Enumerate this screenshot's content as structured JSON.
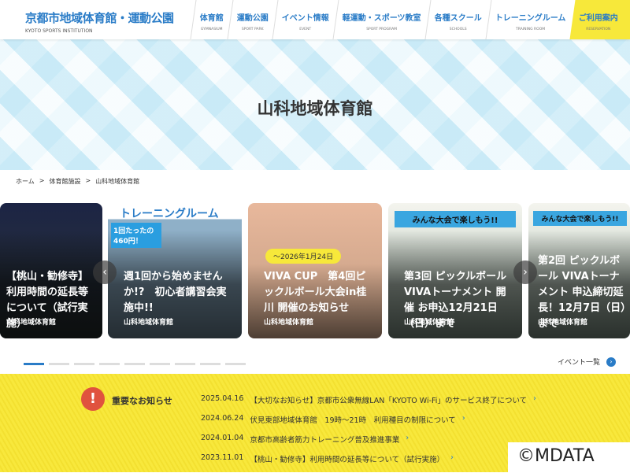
{
  "header": {
    "title": "京都市地域体育館・運動公園",
    "subtitle": "KYOTO SPORTS INSTITUTION",
    "nav": [
      {
        "label": "体育館",
        "en": "GYMNASIUM"
      },
      {
        "label": "運動公園",
        "en": "SPORT PARK"
      },
      {
        "label": "イベント情報",
        "en": "EVENT"
      },
      {
        "label": "軽運動・スポーツ教室",
        "en": "SPORT PROGRAM"
      },
      {
        "label": "各種スクール",
        "en": "SCHOOLS"
      },
      {
        "label": "トレーニングルーム",
        "en": "TRAINING ROOM"
      },
      {
        "label": "ご利用案内",
        "en": "RESERVATION"
      }
    ]
  },
  "hero": {
    "title": "山科地域体育館"
  },
  "breadcrumb": [
    "ホーム",
    "体育館施設",
    "山科地域体育館"
  ],
  "cards": [
    {
      "title": "【桃山・勧修寺】利用時間の延長等について（試行実施）",
      "venue": "山科地域体育館",
      "color": "#2b3450"
    },
    {
      "title": "週1回から始めませんか!?　初心者講習会実施中!!",
      "venue": "山科地域体育館",
      "color": "#6b8fb0",
      "badge": "1回たったの 460円！",
      "img_title": "トレーニングルーム"
    },
    {
      "title": "VIVA CUP　第4回ピックルボール大会in桂川 開催のお知らせ",
      "venue": "山科地域体育館",
      "color": "#d9a98c",
      "badge": "～2026年1月24日"
    },
    {
      "title": "第3回 ピックルボール VIVAトーナメント 開催 お申込12月21日（日）まで",
      "venue": "山科地域体育館",
      "color": "#7fa0a8",
      "img_title": "みんな大会で楽しもう!!"
    },
    {
      "title": "第2回 ピックルボール VIVAトーナメント 申込締切延長！12月7日（日）まで",
      "venue": "山科地域体育館",
      "color": "#7fa0a8",
      "img_title": "みんな大会で楽しもう!!"
    }
  ],
  "carousel": {
    "pages": 9,
    "active": 0
  },
  "event_list_link": "イベント一覧",
  "notices": {
    "heading": "重要なお知らせ",
    "items": [
      {
        "date": "2025.04.16",
        "text": "【大切なお知らせ】京都市公衆無線LAN「KYOTO Wi-Fi」のサービス終了について"
      },
      {
        "date": "2024.06.24",
        "text": "伏見東部地域体育館　19時～21時　利用種目の制限について"
      },
      {
        "date": "2024.01.04",
        "text": "京都市高齢者筋力トレーニング普及推進事業"
      },
      {
        "date": "2023.11.01",
        "text": "【桃山・勧修寺】利用時間の延長等について（試行実施）"
      }
    ]
  },
  "watermark": "©MDATA"
}
